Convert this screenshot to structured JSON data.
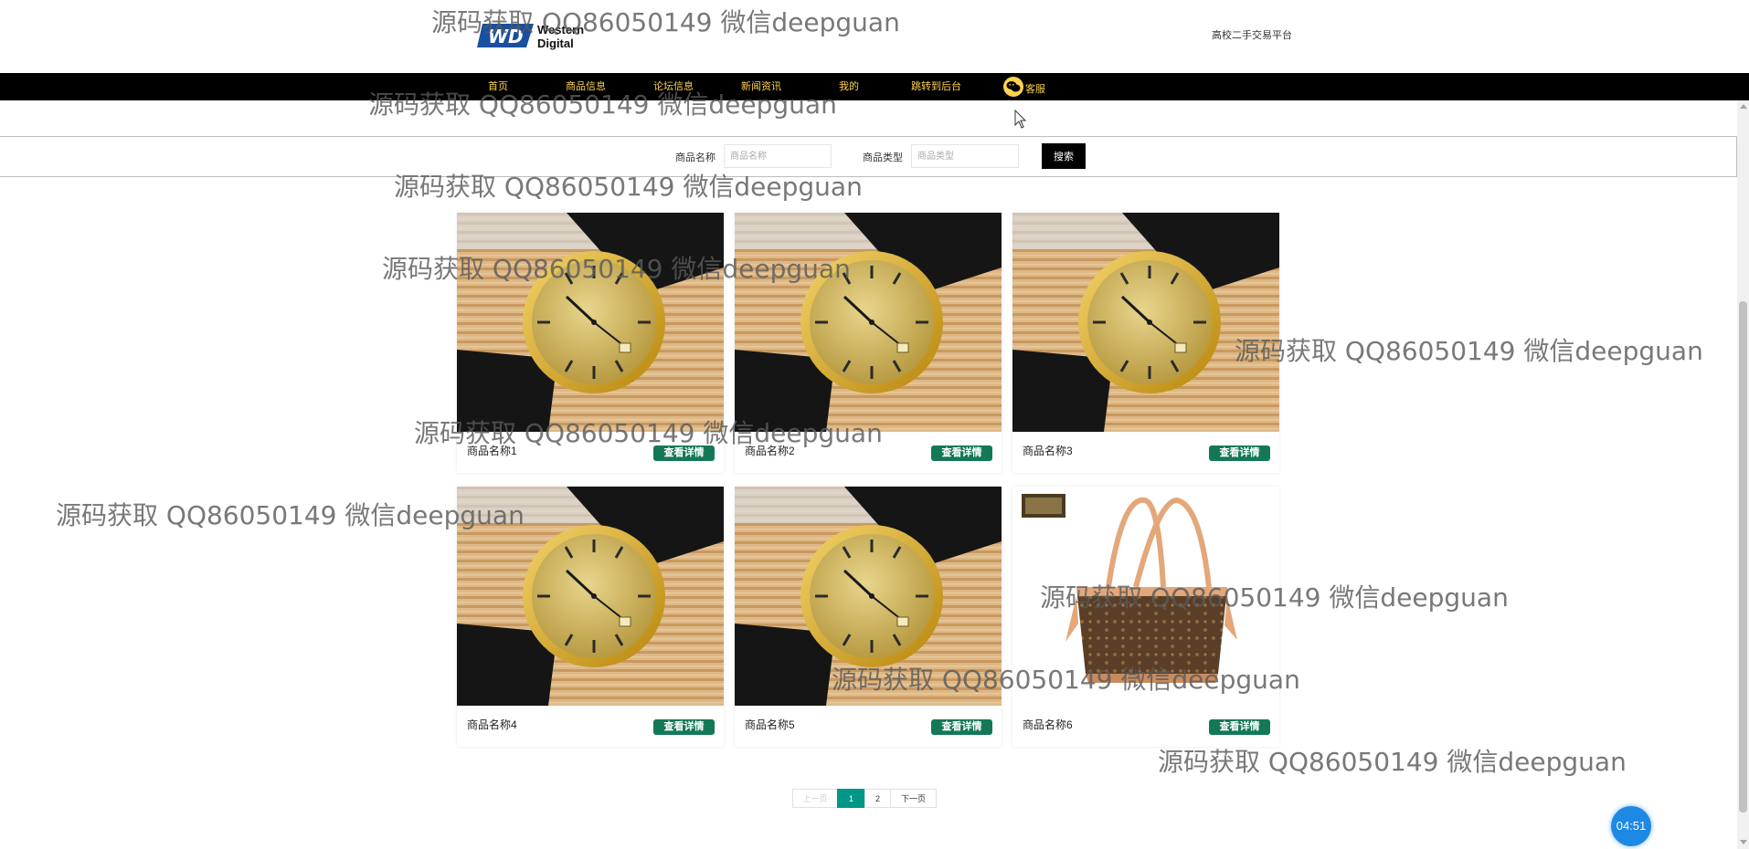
{
  "header": {
    "brand_line1": "Western",
    "brand_line2": "Digital",
    "brand_mark": "WD",
    "site_title": "高校二手交易平台"
  },
  "nav": {
    "items": [
      "首页",
      "商品信息",
      "论坛信息",
      "新闻资讯",
      "我的",
      "跳转到后台"
    ],
    "service_label": "客服"
  },
  "search": {
    "name_label": "商品名称",
    "name_placeholder": "商品名称",
    "type_label": "商品类型",
    "type_placeholder": "商品类型",
    "button_label": "搜索"
  },
  "products": [
    {
      "name": "商品名称1",
      "button": "查看详情",
      "image": "watch"
    },
    {
      "name": "商品名称2",
      "button": "查看详情",
      "image": "watch"
    },
    {
      "name": "商品名称3",
      "button": "查看详情",
      "image": "watch"
    },
    {
      "name": "商品名称4",
      "button": "查看详情",
      "image": "watch"
    },
    {
      "name": "商品名称5",
      "button": "查看详情",
      "image": "watch"
    },
    {
      "name": "商品名称6",
      "button": "查看详情",
      "image": "handbag"
    }
  ],
  "pagination": {
    "prev": "上一页",
    "pages": [
      "1",
      "2"
    ],
    "current": "1",
    "next": "下一页"
  },
  "watermark": "源码获取 QQ86050149 微信deepguan",
  "timer": "04:51",
  "colors": {
    "nav_bg": "#000000",
    "nav_text": "#ffd34e",
    "detail_button": "#147856",
    "page_active": "#009688",
    "timer_bg": "#1e88e5"
  }
}
